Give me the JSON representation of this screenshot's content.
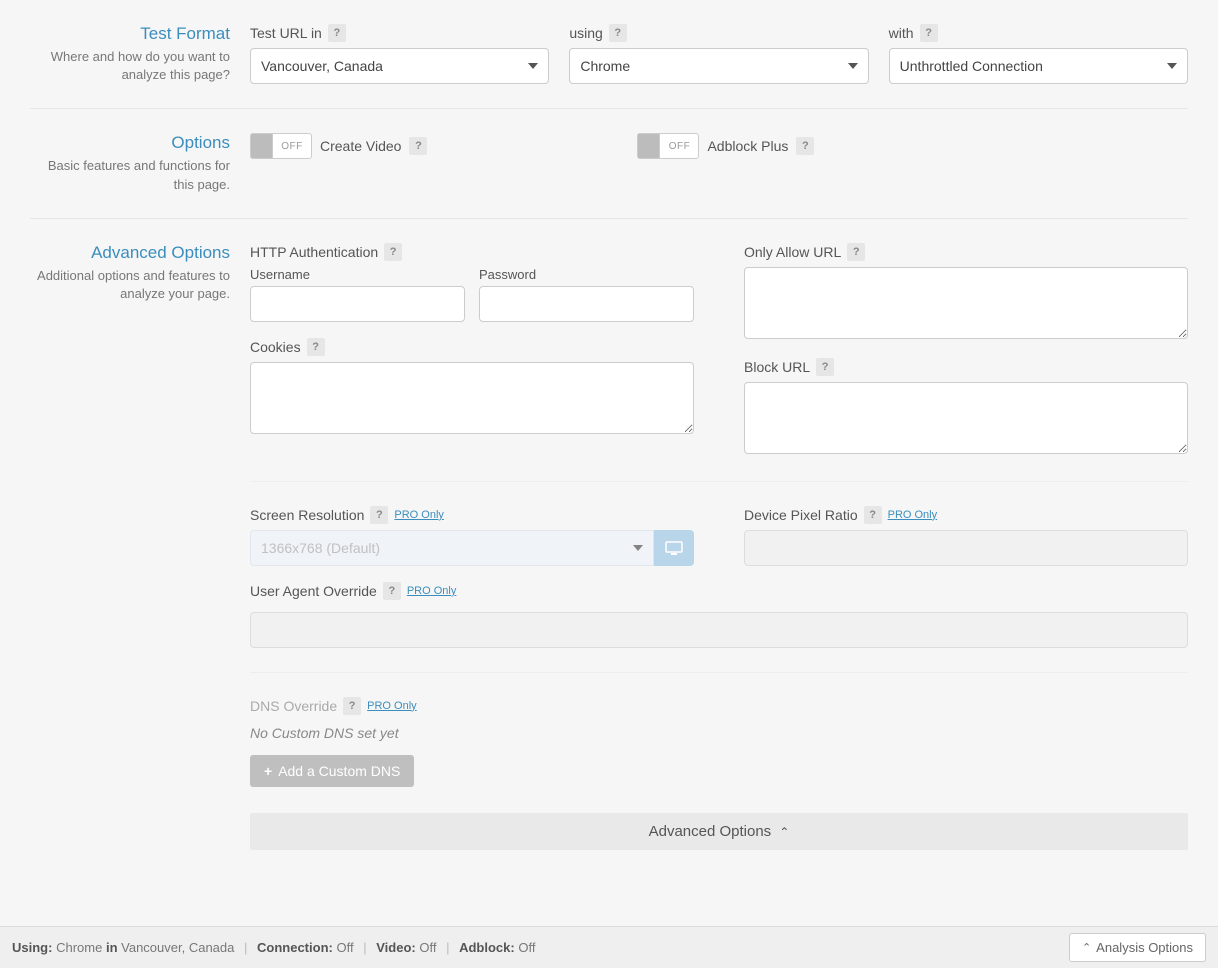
{
  "testFormat": {
    "title": "Test Format",
    "description": "Where and how do you want to analyze this page?",
    "testUrlIn": {
      "label": "Test URL in",
      "value": "Vancouver, Canada"
    },
    "using": {
      "label": "using",
      "value": "Chrome"
    },
    "with": {
      "label": "with",
      "value": "Unthrottled Connection"
    }
  },
  "options": {
    "title": "Options",
    "description": "Basic features and functions for this page.",
    "createVideo": {
      "label": "Create Video",
      "state": "OFF"
    },
    "adblock": {
      "label": "Adblock Plus",
      "state": "OFF"
    }
  },
  "advanced": {
    "title": "Advanced Options",
    "description": "Additional options and features to analyze your page.",
    "httpAuth": {
      "label": "HTTP Authentication",
      "usernameLabel": "Username",
      "passwordLabel": "Password",
      "username": "",
      "password": ""
    },
    "onlyAllow": {
      "label": "Only Allow URL",
      "value": ""
    },
    "cookies": {
      "label": "Cookies",
      "value": ""
    },
    "blockUrl": {
      "label": "Block URL",
      "value": ""
    },
    "screenRes": {
      "label": "Screen Resolution",
      "value": "1366x768 (Default)",
      "pro": "PRO Only"
    },
    "devicePixel": {
      "label": "Device Pixel Ratio",
      "value": "",
      "pro": "PRO Only"
    },
    "userAgent": {
      "label": "User Agent Override",
      "value": "",
      "pro": "PRO Only"
    },
    "dns": {
      "label": "DNS Override",
      "pro": "PRO Only",
      "emptyMsg": "No Custom DNS set yet",
      "addBtn": "Add a Custom DNS"
    },
    "collapseLabel": "Advanced Options"
  },
  "footer": {
    "usingLabel": "Using:",
    "browser": "Chrome",
    "inLabel": "in",
    "location": "Vancouver, Canada",
    "connectionLabel": "Connection:",
    "connectionValue": "Off",
    "videoLabel": "Video:",
    "videoValue": "Off",
    "adblockLabel": "Adblock:",
    "adblockValue": "Off",
    "analysisBtn": "Analysis Options"
  },
  "helpGlyph": "?"
}
